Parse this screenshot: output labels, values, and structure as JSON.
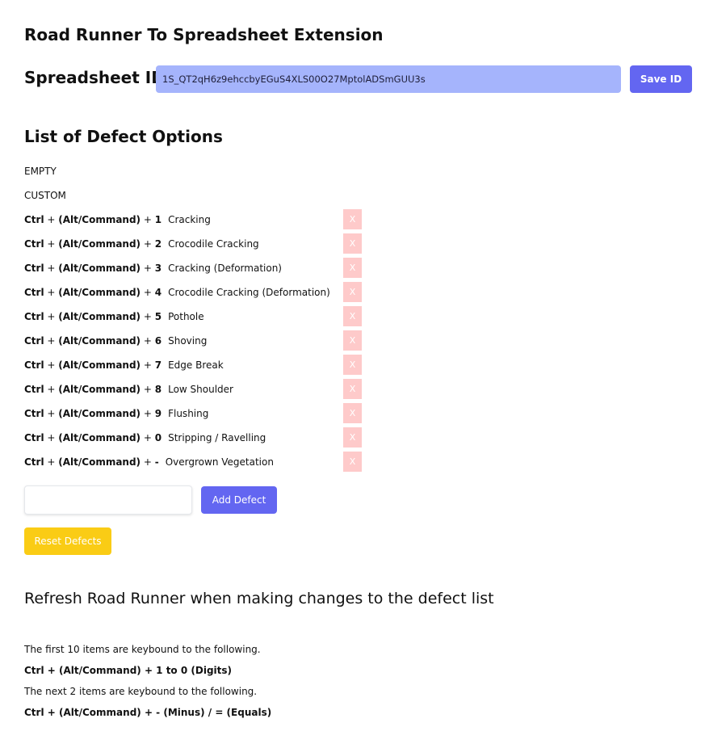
{
  "header": {
    "title": "Road Runner To Spreadsheet Extension"
  },
  "spreadsheet": {
    "label": "Spreadsheet ID",
    "value": "1S_QT2qH6z9ehccbyEGuS4XLS00O27MptolADSmGUU3s",
    "save_label": "Save ID"
  },
  "defects": {
    "section_title": "List of Defect Options",
    "fixed_items": [
      "EMPTY",
      "CUSTOM"
    ],
    "shortcut_prefix": "Ctrl",
    "shortcut_middle": "(Alt/Command)",
    "delete_label": "X",
    "items": [
      {
        "key": "1",
        "name": "Cracking"
      },
      {
        "key": "2",
        "name": "Crocodile Cracking"
      },
      {
        "key": "3",
        "name": "Cracking (Deformation)"
      },
      {
        "key": "4",
        "name": "Crocodile Cracking (Deformation)"
      },
      {
        "key": "5",
        "name": "Pothole"
      },
      {
        "key": "6",
        "name": "Shoving"
      },
      {
        "key": "7",
        "name": "Edge Break"
      },
      {
        "key": "8",
        "name": "Low Shoulder"
      },
      {
        "key": "9",
        "name": "Flushing"
      },
      {
        "key": "0",
        "name": "Stripping / Ravelling"
      },
      {
        "key": "-",
        "name": "Overgrown Vegetation"
      }
    ],
    "new_defect_value": "",
    "add_label": "Add Defect",
    "reset_label": "Reset Defects"
  },
  "notes": {
    "refresh": "Refresh Road Runner when making changes to the defect list",
    "first_line": "The first 10 items are keybound to the following.",
    "first_keys": "Ctrl + (Alt/Command) + 1 to 0 (Digits)",
    "next_line": "The next 2 items are keybound to the following.",
    "next_keys": "Ctrl + (Alt/Command) + - (Minus) / = (Equals)"
  },
  "colors": {
    "primary": "#6366f1",
    "input_fill": "#a5b4fc",
    "delete": "#fecaca",
    "reset": "#facc15"
  }
}
